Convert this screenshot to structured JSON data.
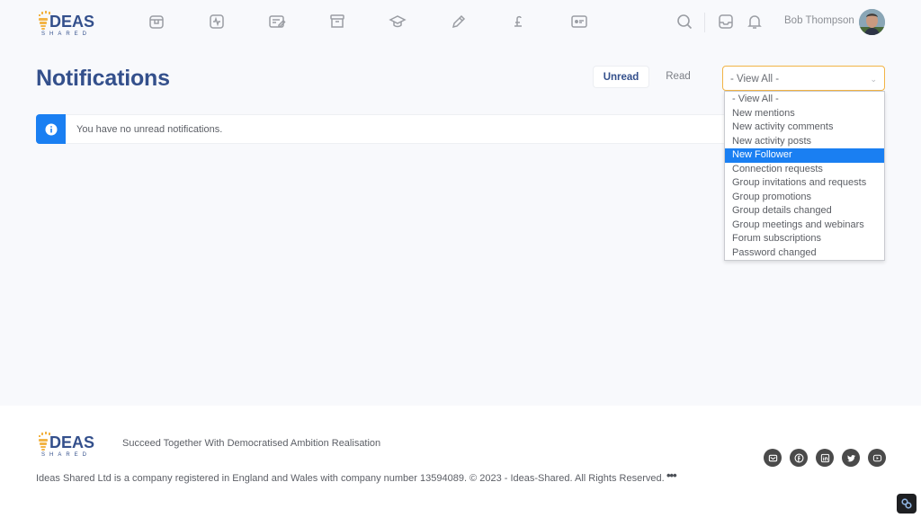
{
  "brand": {
    "logo_text": "IDEAS",
    "logo_subtext": "SHARED",
    "primary_color": "#34508c",
    "accent_color": "#f2b446"
  },
  "header": {
    "nav_icons": [
      {
        "name": "marketplace-icon"
      },
      {
        "name": "activity-icon"
      },
      {
        "name": "projects-icon"
      },
      {
        "name": "archive-icon"
      },
      {
        "name": "learning-icon"
      },
      {
        "name": "blog-icon"
      },
      {
        "name": "funding-icon"
      },
      {
        "name": "profile-card-icon"
      }
    ],
    "user_name": "Bob Thompson"
  },
  "main": {
    "title": "Notifications",
    "tabs": [
      {
        "label": "Unread",
        "active": true
      },
      {
        "label": "Read",
        "active": false
      }
    ],
    "filter": {
      "selected": "- View All -",
      "highlighted": "New Follower",
      "options": [
        "- View All -",
        "New mentions",
        "New activity comments",
        "New activity posts",
        "New Follower",
        "Connection requests",
        "Group invitations and requests",
        "Group promotions",
        "Group details changed",
        "Group meetings and webinars",
        "Forum subscriptions",
        "Password changed"
      ]
    },
    "alert": {
      "message": "You have no unread notifications.",
      "color": "#1a7ff2"
    }
  },
  "footer": {
    "tagline": "Succeed Together With Democratised Ambition Realisation",
    "legal": "Ideas Shared Ltd is a company registered in England and Wales with company number 13594089. © 2023 - Ideas-Shared. All Rights Reserved.",
    "more_label": "•••",
    "social": [
      "email",
      "facebook",
      "linkedin",
      "twitter",
      "youtube"
    ]
  }
}
